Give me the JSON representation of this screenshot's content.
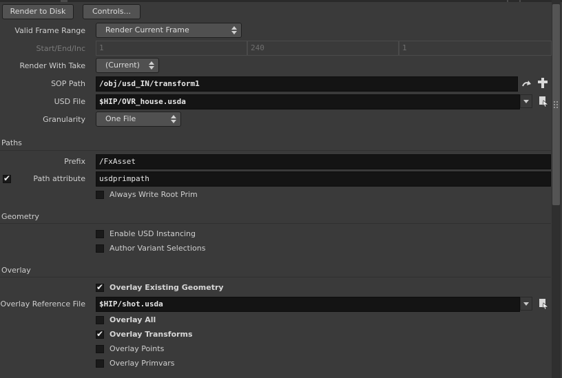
{
  "toolbar": {
    "render_to_disk": "Render to Disk",
    "controls": "Controls..."
  },
  "params": {
    "valid_frame_range": {
      "label": "Valid Frame Range",
      "value": "Render Current Frame"
    },
    "start_end_inc": {
      "label": "Start/End/Inc",
      "start": "1",
      "end": "240",
      "inc": "1"
    },
    "render_with_take": {
      "label": "Render With Take",
      "value": "(Current)"
    },
    "sop_path": {
      "label": "SOP Path",
      "value": "/obj/usd_IN/transform1"
    },
    "usd_file": {
      "label": "USD File",
      "value": "$HIP/OVR_house.usda"
    },
    "granularity": {
      "label": "Granularity",
      "value": "One File"
    }
  },
  "paths": {
    "section_title": "Paths",
    "prefix": {
      "label": "Prefix",
      "value": "/FxAsset"
    },
    "path_attribute": {
      "label": "Path attribute",
      "value": "usdprimpath",
      "enabled": true
    },
    "always_write_root_prim": {
      "label": "Always Write Root Prim",
      "checked": false
    }
  },
  "geometry": {
    "section_title": "Geometry",
    "enable_usd_instancing": {
      "label": "Enable USD Instancing",
      "checked": false
    },
    "author_variant_selections": {
      "label": "Author Variant Selections",
      "checked": false
    }
  },
  "overlay": {
    "section_title": "Overlay",
    "overlay_existing_geometry": {
      "label": "Overlay Existing Geometry",
      "checked": true
    },
    "overlay_reference_file": {
      "label": "Overlay Reference File",
      "value": "$HIP/shot.usda"
    },
    "overlay_all": {
      "label": "Overlay All",
      "checked": false
    },
    "overlay_transforms": {
      "label": "Overlay Transforms",
      "checked": true
    },
    "overlay_points": {
      "label": "Overlay Points",
      "checked": false
    },
    "overlay_primvars": {
      "label": "Overlay Primvars",
      "checked": false
    }
  },
  "icons": {
    "jump": "jump-to-operator-icon",
    "chooser": "operator-chooser-icon",
    "file": "file-browse-icon"
  }
}
